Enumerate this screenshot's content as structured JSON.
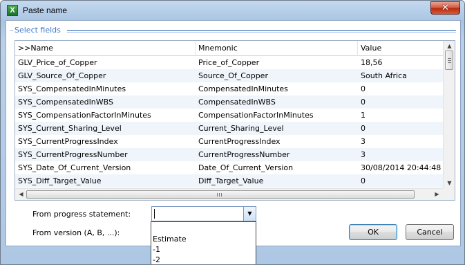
{
  "window": {
    "title": "Paste name",
    "close_glyph": "✕",
    "app_icon": "X"
  },
  "fieldset": {
    "legend": "Select fields"
  },
  "table": {
    "columns": [
      ">>Name",
      "Mnemonic",
      "Value"
    ],
    "rows": [
      {
        "name": "GLV_Price_of_Copper",
        "mnemonic": "Price_of_Copper",
        "value": "18,56"
      },
      {
        "name": "GLV_Source_Of_Copper",
        "mnemonic": "Source_Of_Copper",
        "value": "South Africa"
      },
      {
        "name": "SYS_CompensatedInMinutes",
        "mnemonic": "CompensatedInMinutes",
        "value": "0"
      },
      {
        "name": "SYS_CompensatedInWBS",
        "mnemonic": "CompensatedInWBS",
        "value": "0"
      },
      {
        "name": "SYS_CompensationFactorInMinutes",
        "mnemonic": "CompensationFactorInMinutes",
        "value": "1"
      },
      {
        "name": "SYS_Current_Sharing_Level",
        "mnemonic": "Current_Sharing_Level",
        "value": "0"
      },
      {
        "name": "SYS_CurrentProgressIndex",
        "mnemonic": "CurrentProgressIndex",
        "value": "3"
      },
      {
        "name": "SYS_CurrentProgressNumber",
        "mnemonic": "CurrentProgressNumber",
        "value": "3"
      },
      {
        "name": "SYS_Date_Of_Current_Version",
        "mnemonic": "Date_Of_Current_Version",
        "value": "30/08/2014 20:44:48"
      },
      {
        "name": "SYS_Diff_Target_Value",
        "mnemonic": "Diff_Target_Value",
        "value": "0"
      }
    ]
  },
  "form": {
    "progress_label": "From progress statement:",
    "progress_value": "",
    "version_label": "From version (A, B, ...):",
    "dropdown_options": [
      "",
      "Estimate",
      "-1",
      "-2"
    ]
  },
  "buttons": {
    "ok": "OK",
    "cancel": "Cancel"
  },
  "icons": {
    "close": "close-icon",
    "app": "app-icon",
    "dropdown_arrow": "chevron-down-icon",
    "scroll_up": "arrow-up-icon",
    "scroll_down": "arrow-down-icon",
    "scroll_left": "arrow-left-icon",
    "scroll_right": "arrow-right-icon"
  }
}
